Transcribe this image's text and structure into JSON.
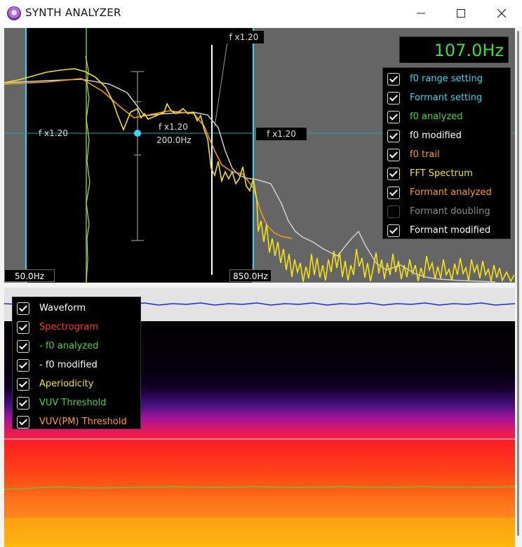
{
  "window": {
    "title": "SYNTH ANALYZER"
  },
  "readout": {
    "frequency": "107.0Hz"
  },
  "upper_panel": {
    "range_left": "50.0Hz",
    "range_right": "850.0Hz",
    "fx_top": "f x1.20",
    "fx_left": "f x1.20",
    "fx_center": "f x1.20",
    "fx_center_value": "200.0Hz",
    "fx_right": "f x1.20"
  },
  "legend_upper": [
    {
      "label": "f0 range setting",
      "checked": true,
      "color": "#34d6f0"
    },
    {
      "label": "Formant setting",
      "checked": true,
      "color": "#34d6f0"
    },
    {
      "label": "f0 analyzed",
      "checked": true,
      "color": "#4bd43a"
    },
    {
      "label": "f0 modified",
      "checked": true,
      "color": "#ffffff"
    },
    {
      "label": "f0 trail",
      "checked": true,
      "color": "#ff9a1a"
    },
    {
      "label": "FFT Spectrum",
      "checked": true,
      "color": "#f2e21a"
    },
    {
      "label": "Formant analyzed",
      "checked": true,
      "color": "#ff9a1a"
    },
    {
      "label": "Formant doubling",
      "checked": false,
      "color": "#8a8a8a"
    },
    {
      "label": "Formant modified",
      "checked": true,
      "color": "#ffffff"
    }
  ],
  "legend_lower": [
    {
      "label": "Waveform",
      "checked": true,
      "color": "#ffffff"
    },
    {
      "label": "Spectrogram",
      "checked": true,
      "color": "#ff3a1a"
    },
    {
      "label": "- f0 analyzed",
      "checked": true,
      "color": "#4bd43a"
    },
    {
      "label": "- f0 modified",
      "checked": true,
      "color": "#ffffff"
    },
    {
      "label": "Aperiodicity",
      "checked": true,
      "color": "#f2e21a"
    },
    {
      "label": "VUV Threshold",
      "checked": true,
      "color": "#4bd43a"
    },
    {
      "label": "VUV(PM) Threshold",
      "checked": true,
      "color": "#ff9a1a"
    }
  ]
}
